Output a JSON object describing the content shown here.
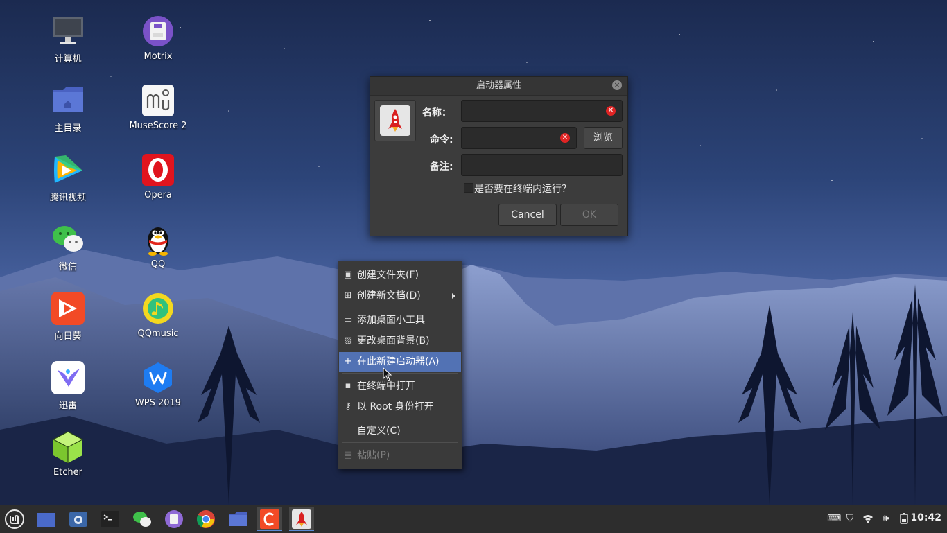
{
  "desktop": {
    "icons": [
      {
        "label": "计算机",
        "icon": "computer-icon"
      },
      {
        "label": "主目录",
        "icon": "home-folder-icon"
      },
      {
        "label": "腾讯视频",
        "icon": "tencent-video-icon"
      },
      {
        "label": "微信",
        "icon": "wechat-icon"
      },
      {
        "label": "向日葵",
        "icon": "sunflower-icon"
      },
      {
        "label": "迅雷",
        "icon": "thunder-icon"
      },
      {
        "label": "Etcher",
        "icon": "etcher-icon"
      },
      {
        "label": "Motrix",
        "icon": "motrix-icon"
      },
      {
        "label": "MuseScore 2",
        "icon": "musescore-icon"
      },
      {
        "label": "Opera",
        "icon": "opera-icon"
      },
      {
        "label": "QQ",
        "icon": "qq-icon"
      },
      {
        "label": "QQmusic",
        "icon": "qqmusic-icon"
      },
      {
        "label": "WPS 2019",
        "icon": "wps-icon"
      }
    ]
  },
  "dialog": {
    "title": "启动器属性",
    "name_label": "名称：",
    "command_label": "命令:",
    "comment_label": "备注:",
    "name_value": "",
    "command_value": "",
    "comment_value": "",
    "browse_label": "浏览",
    "terminal_checkbox_label": "是否要在终端内运行？",
    "terminal_checked": false,
    "cancel_label": "Cancel",
    "ok_label": "OK"
  },
  "context_menu": {
    "items": [
      {
        "label": "创建文件夹(F)",
        "icon": "new-folder-icon"
      },
      {
        "label": "创建新文档(D)",
        "icon": "new-document-icon",
        "submenu": true
      },
      {
        "label": "添加桌面小工具",
        "icon": "desklet-icon"
      },
      {
        "label": "更改桌面背景(B)",
        "icon": "wallpaper-icon"
      },
      {
        "label": "在此新建启动器(A)",
        "icon": "plus-icon",
        "highlighted": true
      },
      {
        "label": "在终端中打开",
        "icon": "terminal-icon"
      },
      {
        "label": "以 Root 身份打开",
        "icon": "key-icon"
      },
      {
        "label": "自定义(C)",
        "icon": ""
      },
      {
        "label": "粘贴(P)",
        "icon": "paste-icon",
        "disabled": true
      }
    ]
  },
  "taskbar": {
    "clock": "10:42",
    "apps": [
      "menu",
      "show-desktop",
      "screenshot",
      "terminal",
      "wechat",
      "motrix",
      "chrome",
      "files",
      "app-c",
      "launcher-properties"
    ],
    "active_app": "launcher-properties",
    "accent_color": "#5b8bd6"
  }
}
